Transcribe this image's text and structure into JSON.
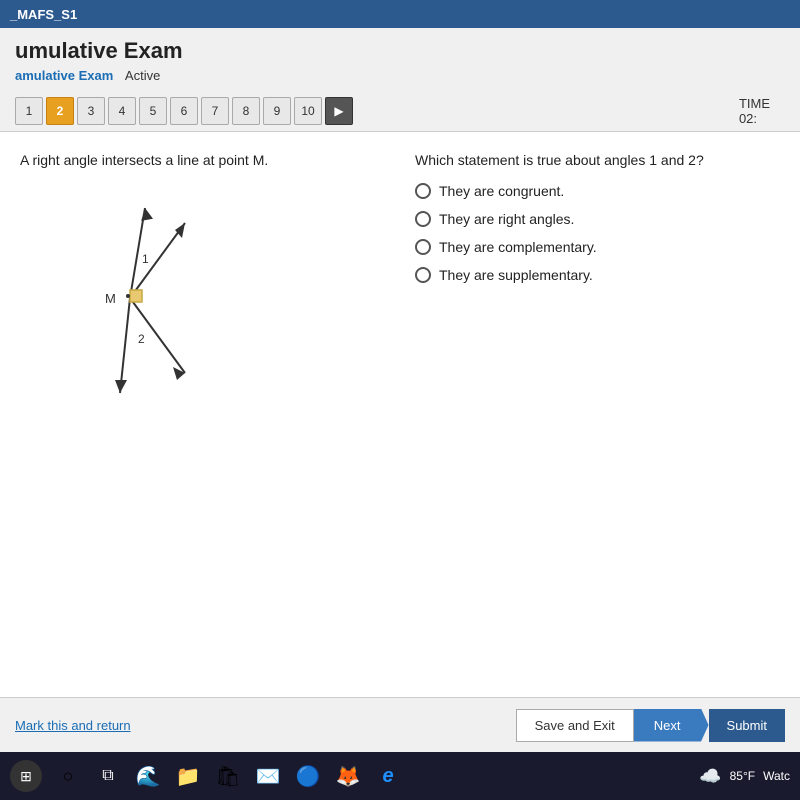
{
  "topbar": {
    "title": "_MAFS_S1"
  },
  "header": {
    "title": "umulative Exam",
    "subtitle_exam": "amulative Exam",
    "subtitle_status": "Active"
  },
  "nav": {
    "pages": [
      "1",
      "2",
      "3",
      "4",
      "5",
      "6",
      "7",
      "8",
      "9",
      "10"
    ],
    "active_page": 2,
    "time_label": "TIME",
    "time_value": "02:"
  },
  "question": {
    "left_text": "A right angle intersects a line at point M.",
    "right_text": "Which statement is true about angles 1 and 2?",
    "options": [
      "They are congruent.",
      "They are right angles.",
      "They are complementary.",
      "They are supplementary."
    ]
  },
  "footer": {
    "mark_link": "Mark this and return",
    "save_exit": "Save and Exit",
    "next": "Next",
    "submit": "Submit"
  },
  "taskbar": {
    "temp": "85°F",
    "watch": "Watc"
  }
}
